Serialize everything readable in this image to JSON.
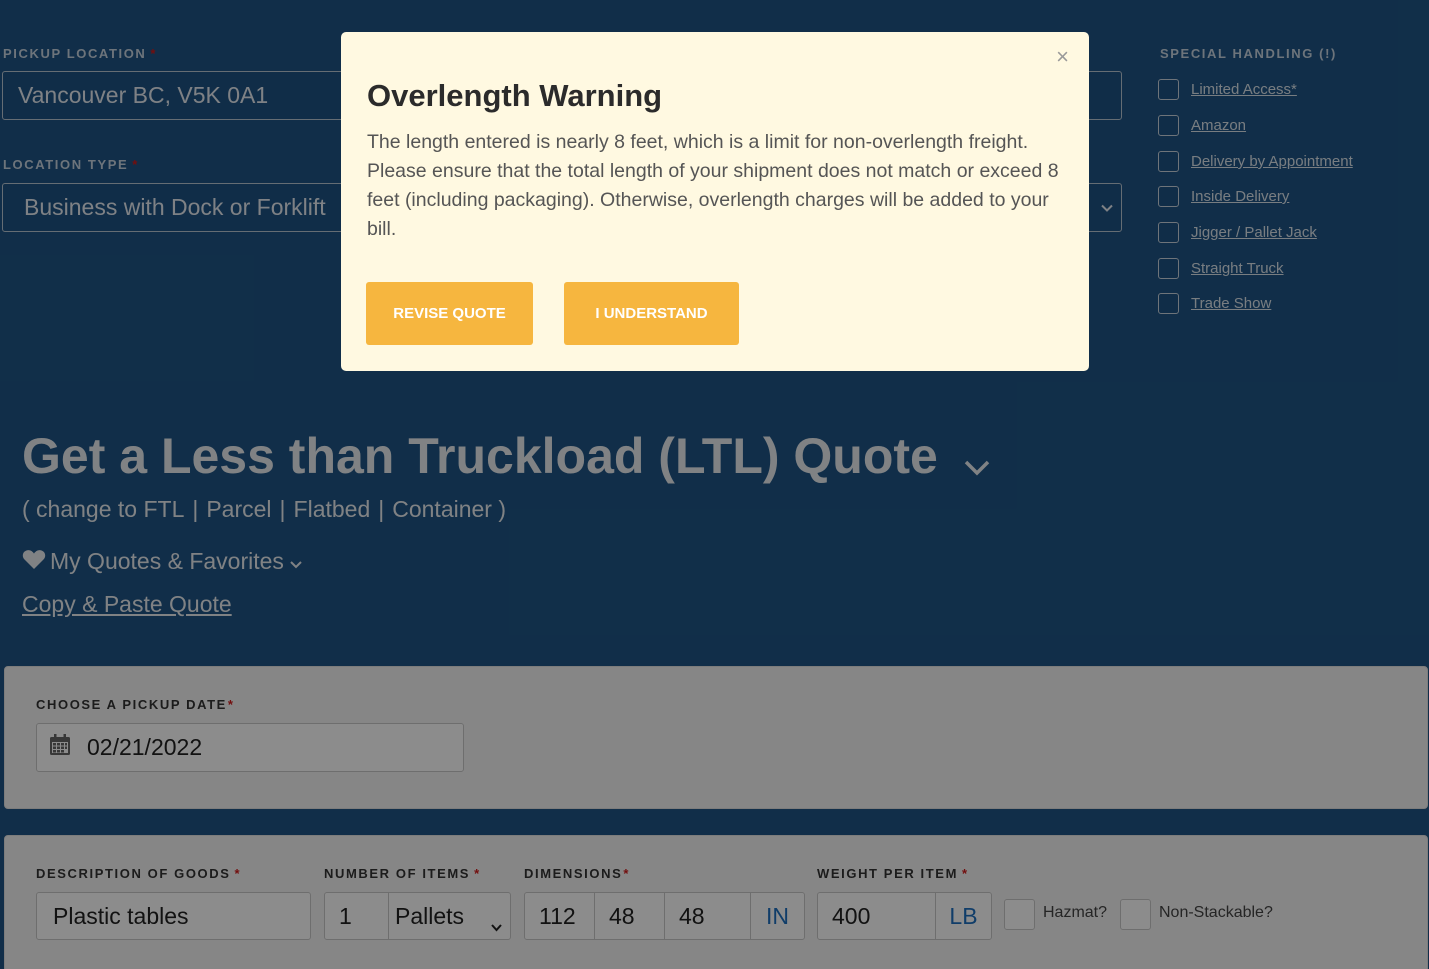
{
  "pickup": {
    "label": "PICKUP LOCATION",
    "required": "*",
    "value": "Vancouver BC, V5K 0A1"
  },
  "location_type": {
    "label": "LOCATION TYPE",
    "required": "*",
    "value": "Business with Dock or Forklift"
  },
  "special_handling": {
    "title": "SPECIAL HANDLING (!)",
    "items": [
      {
        "label": "Limited Access*"
      },
      {
        "label": "Amazon"
      },
      {
        "label": "Delivery by Appointment"
      },
      {
        "label": "Inside Delivery"
      },
      {
        "label": "Jigger / Pallet Jack"
      },
      {
        "label": "Straight Truck"
      },
      {
        "label": "Trade Show"
      }
    ]
  },
  "ltl": {
    "title": "Get a Less than Truckload (LTL) Quote",
    "change_prefix": "( change to FTL",
    "sep": "|",
    "parcel": "Parcel",
    "flatbed": "Flatbed",
    "container": "Container )",
    "favorites": "My Quotes & Favorites",
    "copy_paste": "Copy & Paste Quote"
  },
  "pickup_date": {
    "label": "CHOOSE A PICKUP DATE",
    "required": "*",
    "value": "02/21/2022"
  },
  "goods": {
    "desc_label": "DESCRIPTION OF GOODS",
    "desc_value": "Plastic tables",
    "num_label": "NUMBER OF ITEMS",
    "num_value": "1",
    "unit_value": "Pallets",
    "dim_label": "DIMENSIONS",
    "dim_l": "112",
    "dim_w": "48",
    "dim_h": "48",
    "dim_unit": "IN",
    "weight_label": "WEIGHT PER ITEM",
    "weight_value": "400",
    "weight_unit": "LB",
    "hazmat": "Hazmat?",
    "nonstack": "Non-Stackable?",
    "required": "*"
  },
  "modal": {
    "close": "×",
    "title": "Overlength Warning",
    "body": "The length entered is nearly 8 feet, which is a limit for non-overlength freight. Please ensure that the total length of your shipment does not match or exceed 8 feet (including packaging). Otherwise, overlength charges will be added to your bill.",
    "revise_label": "REVISE QUOTE",
    "understand_label": "I UNDERSTAND"
  }
}
